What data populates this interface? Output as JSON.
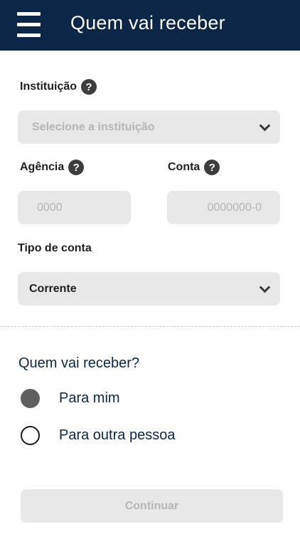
{
  "header": {
    "title": "Quem vai receber"
  },
  "form": {
    "instituicao": {
      "label": "Instituição",
      "help": "?",
      "placeholder": "Selecione a instituição"
    },
    "agencia": {
      "label": "Agência",
      "help": "?",
      "placeholder": "0000"
    },
    "conta": {
      "label": "Conta",
      "help": "?",
      "placeholder": "0000000-0"
    },
    "tipo_conta": {
      "label": "Tipo de conta",
      "value": "Corrente"
    }
  },
  "recipient": {
    "question": "Quem vai receber?",
    "options": [
      {
        "label": "Para mim",
        "selected": true
      },
      {
        "label": "Para outra pessoa",
        "selected": false
      }
    ]
  },
  "actions": {
    "continue_label": "Continuar"
  },
  "colors": {
    "header_bg": "#0c2647",
    "field_bg": "#e8e8e8",
    "placeholder": "#b5b5b5",
    "accent_text": "#0c2647"
  }
}
